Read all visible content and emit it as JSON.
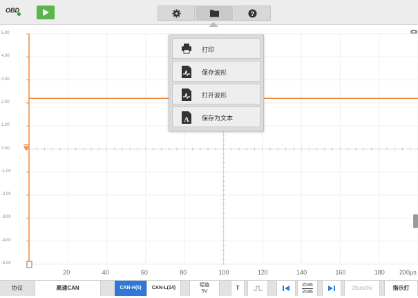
{
  "topbar": {
    "obd_label": "OBD",
    "play_button": "play",
    "tools": [
      {
        "name": "gear-icon"
      },
      {
        "name": "folder-icon"
      },
      {
        "name": "help-icon"
      }
    ]
  },
  "file_menu": {
    "items": [
      {
        "label": "打印",
        "icon": "printer-icon"
      },
      {
        "label": "保存波形",
        "icon": "save-waveform-icon"
      },
      {
        "label": "打开波形",
        "icon": "open-waveform-icon"
      },
      {
        "label": "保存为文本",
        "icon": "save-text-icon"
      }
    ]
  },
  "chart_data": {
    "type": "line",
    "y_ticks": [
      "5.00",
      "4.00",
      "3.00",
      "2.00",
      "1.00",
      "0.00",
      "-1.00",
      "-2.00",
      "-3.00",
      "-4.00",
      "-5.00"
    ],
    "x_ticks": [
      "20",
      "40",
      "60",
      "80",
      "100",
      "120",
      "140",
      "160",
      "180"
    ],
    "x_unit": "200μs",
    "ylim": [
      -5,
      5
    ],
    "xlim": [
      0,
      200
    ],
    "grid": true,
    "series": [
      {
        "color": "#f08a3c",
        "x": [
          0,
          200
        ],
        "y": [
          2.2,
          2.2
        ]
      }
    ],
    "trigger_level": 0.0
  },
  "bottombar": {
    "protocol_label": "协议",
    "protocol_value": "高速CAN",
    "channel_1": "CAN-H(6)",
    "channel_2": "CAN-L(14)",
    "amplitude_label": "幅值",
    "amplitude_value": "5V",
    "trigger_t": "T",
    "page_top": "2046",
    "page_bottom": "2046",
    "timebase": "20μs/div",
    "indicator": "指示灯"
  },
  "colors": {
    "accent_blue": "#2f78d6",
    "play_green": "#58b748",
    "waveform": "#f08a3c",
    "axis_orange": "#f08a3c"
  }
}
